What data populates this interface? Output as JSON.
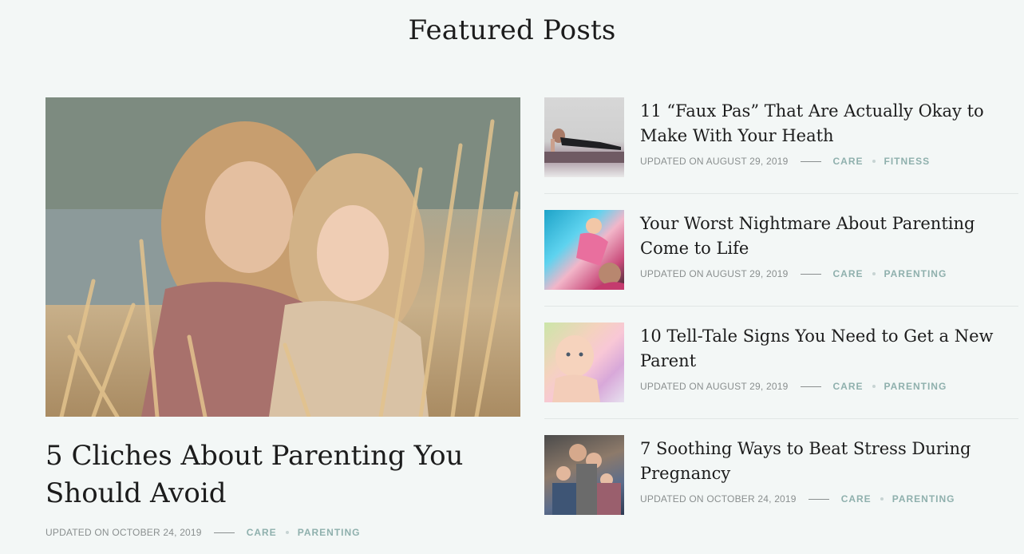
{
  "section": {
    "title": "Featured Posts"
  },
  "feature": {
    "image_alt": "mother and daughter in wheat field",
    "title": "5 Cliches About Parenting You Should Avoid",
    "date": "UPDATED ON OCTOBER 24, 2019",
    "categories": [
      "CARE",
      "PARENTING"
    ]
  },
  "posts": [
    {
      "title": "11 “Faux Pas” That Are Actually Okay to Make With Your Heath",
      "date": "UPDATED ON AUGUST 29, 2019",
      "categories": [
        "CARE",
        "FITNESS"
      ]
    },
    {
      "title": "Your Worst Nightmare About Parenting Come to Life",
      "date": "UPDATED ON AUGUST 29, 2019",
      "categories": [
        "CARE",
        "PARENTING"
      ]
    },
    {
      "title": "10 Tell-Tale Signs You Need to Get a New Parent",
      "date": "UPDATED ON AUGUST 29, 2019",
      "categories": [
        "CARE",
        "PARENTING"
      ]
    },
    {
      "title": "7 Soothing Ways to Beat Stress During Pregnancy",
      "date": "UPDATED ON OCTOBER 24, 2019",
      "categories": [
        "CARE",
        "PARENTING"
      ]
    }
  ],
  "colors": {
    "background": "#f3f7f6",
    "category": "#8fb0ad",
    "meta": "#8a8f8f"
  }
}
